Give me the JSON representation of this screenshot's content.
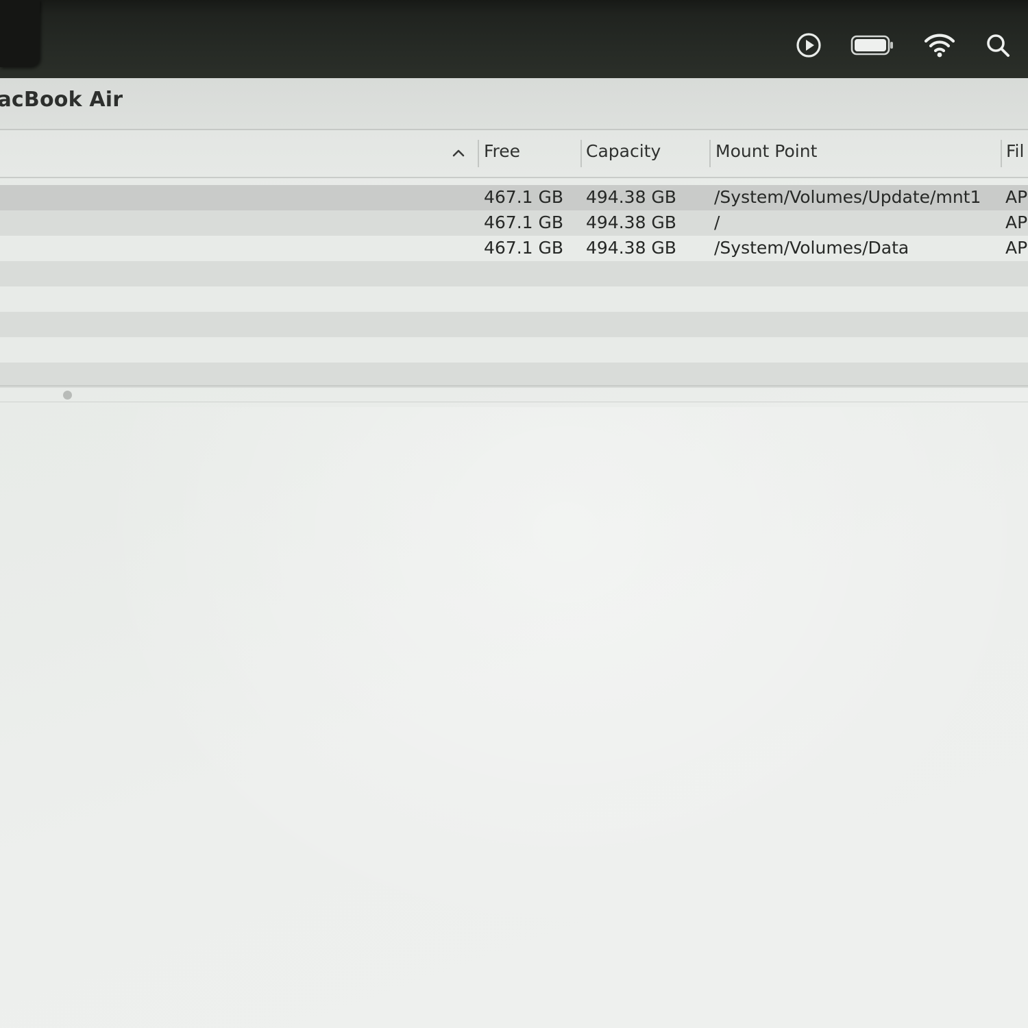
{
  "menubar": {
    "icons": [
      "play-circle-icon",
      "battery-icon",
      "wifi-icon",
      "search-icon"
    ]
  },
  "window": {
    "title": "lacBook Air"
  },
  "table": {
    "sort_icon": "chevron-up-icon",
    "columns": [
      {
        "label": "Free"
      },
      {
        "label": "Capacity"
      },
      {
        "label": "Mount Point"
      },
      {
        "label": "Fil"
      }
    ],
    "rows": [
      {
        "free": "467.1 GB",
        "capacity": "494.38 GB",
        "mount_point": "/System/Volumes/Update/mnt1",
        "file_system": "AP",
        "selected": true
      },
      {
        "free": "467.1 GB",
        "capacity": "494.38 GB",
        "mount_point": "/",
        "file_system": "AP",
        "selected": false
      },
      {
        "free": "467.1 GB",
        "capacity": "494.38 GB",
        "mount_point": "/System/Volumes/Data",
        "file_system": "AP",
        "selected": false
      }
    ]
  },
  "colors": {
    "menubar": "#262a25",
    "window": "#e9ece9",
    "selected_row": "#c9cbc9",
    "alt_row": "#d9dcd9",
    "text": "#262826"
  }
}
